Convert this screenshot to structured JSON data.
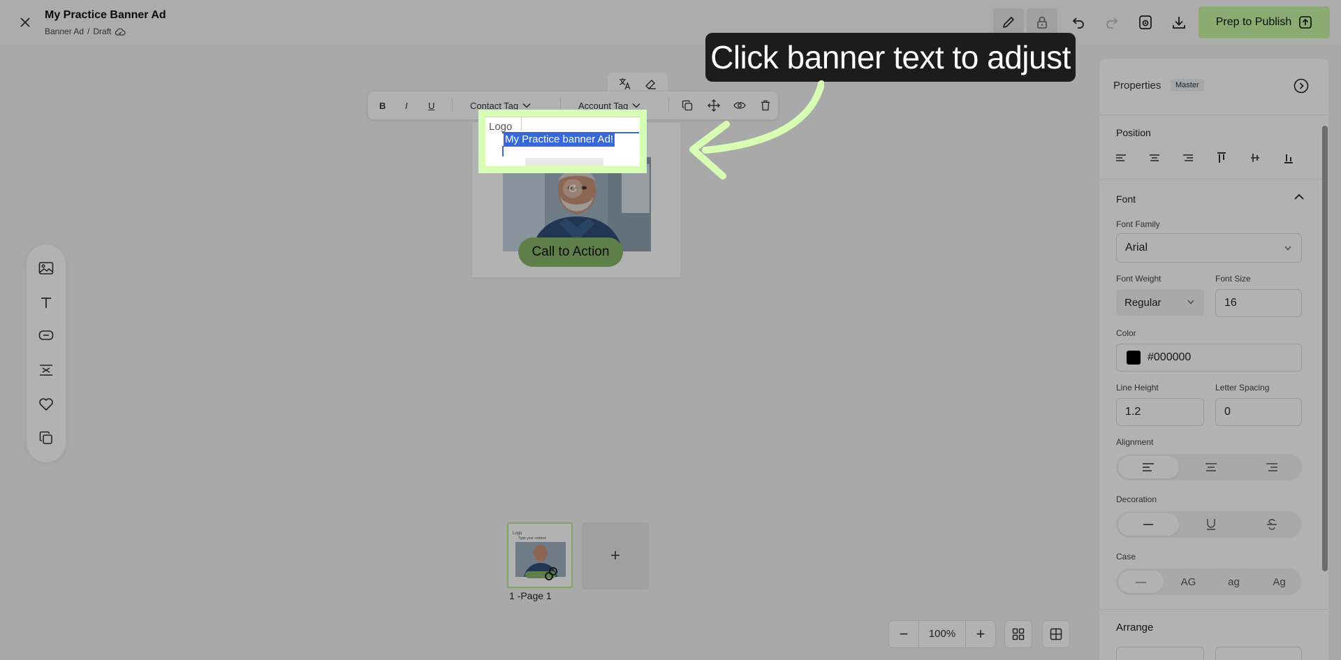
{
  "header": {
    "title": "My Practice Banner Ad",
    "breadcrumb_type": "Banner Ad",
    "breadcrumb_sep": "/",
    "breadcrumb_status": "Draft",
    "publish_label": "Prep to Publish",
    "icons": [
      "close-icon",
      "cloud-check-icon",
      "pencil-icon",
      "lock-icon",
      "undo-icon",
      "redo-icon",
      "preview-icon",
      "download-icon",
      "publish-icon"
    ]
  },
  "format_toolbar": {
    "bold": "B",
    "italic": "I",
    "underline": "U",
    "contact_tag": "Contact Tag",
    "account_tag": "Account Tag"
  },
  "banner": {
    "logo": "Logo",
    "headline": "My Practice banner Ad!",
    "cta": "Call to Action"
  },
  "callout": {
    "text": "Click banner text to adjust",
    "accent_color": "#d6ffb3"
  },
  "pages": {
    "items": [
      {
        "label": "1 -Page 1",
        "thumb_logo": "Logo",
        "thumb_text": "Type your content"
      }
    ],
    "add_label": "+"
  },
  "zoom": {
    "minus": "−",
    "value": "100%",
    "plus": "+"
  },
  "properties": {
    "title": "Properties",
    "badge": "Master",
    "position_label": "Position",
    "font_section": "Font",
    "font_family_label": "Font Family",
    "font_family_value": "Arial",
    "font_weight_label": "Font Weight",
    "font_weight_value": "Regular",
    "font_size_label": "Font Size",
    "font_size_value": "16",
    "color_label": "Color",
    "color_value": "#000000",
    "line_height_label": "Line Height",
    "line_height_value": "1.2",
    "letter_spacing_label": "Letter Spacing",
    "letter_spacing_value": "0",
    "alignment_label": "Alignment",
    "decoration_label": "Decoration",
    "case_label": "Case",
    "case_options": [
      "—",
      "AG",
      "ag",
      "Ag"
    ],
    "arrange_label": "Arrange"
  },
  "colors": {
    "publish_bg": "#c6f5a3",
    "cta_bg": "#88b76a",
    "selection": "#3569d8"
  }
}
